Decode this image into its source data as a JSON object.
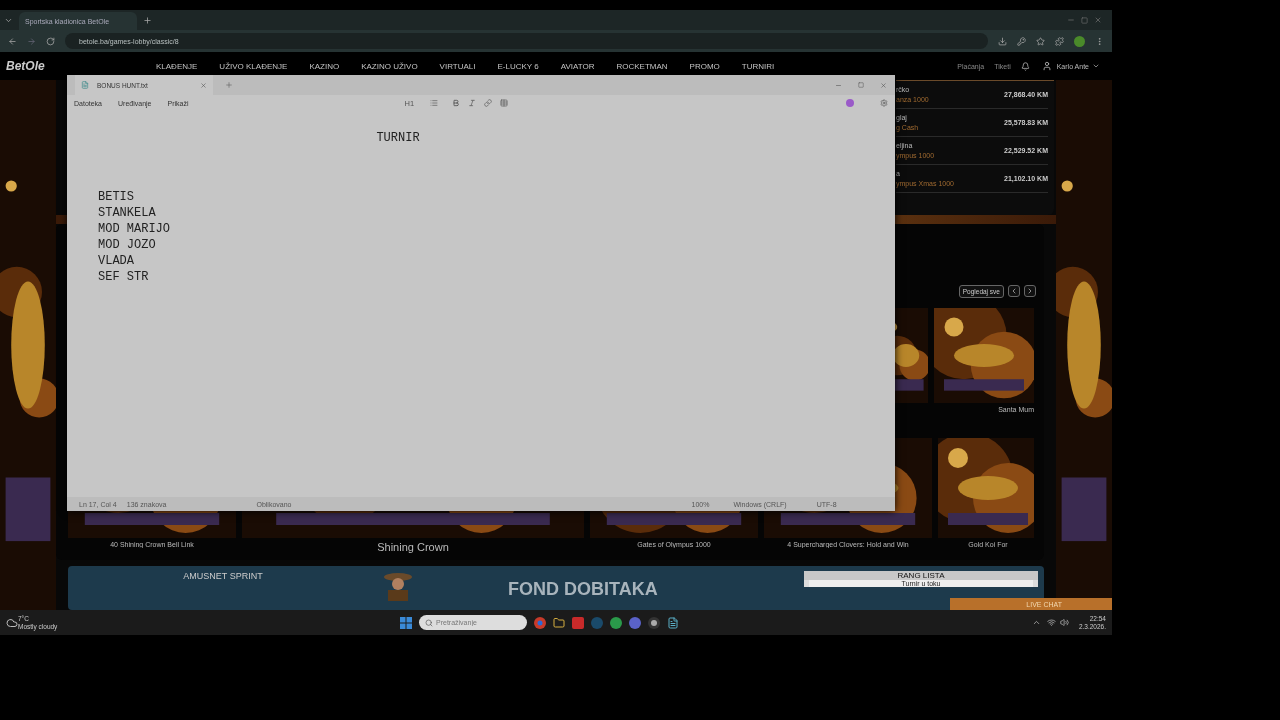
{
  "browser": {
    "tabs": [
      {
        "title": "Sportska kladionica BetOle",
        "selected": true
      }
    ],
    "url": "betole.ba/games-lobby/classic/8"
  },
  "site": {
    "logo": "BetOle",
    "nav": [
      "KLAĐENJE",
      "UŽIVO KLAĐENJE",
      "KAZINO",
      "KAZINO UŽIVO",
      "VIRTUALI",
      "E-LUCKY 6",
      "AVIATOR",
      "ROCKETMAN",
      "PROMO",
      "TURNIRI"
    ],
    "user_links": [
      "Plaćanja",
      "Tiketi"
    ],
    "user_name": "Karlo Ante"
  },
  "leaderboard": [
    {
      "name": "rčko",
      "game": "anza 1000",
      "amount": "27,868.40 KM"
    },
    {
      "name": "glaj",
      "game": "g Cash",
      "amount": "25,578.83 KM"
    },
    {
      "name": "eljina",
      "game": "ympus 1000",
      "amount": "22,529.52 KM"
    },
    {
      "name": "a",
      "game": "ympus Xmas 1000",
      "amount": "21,102.10 KM"
    }
  ],
  "games": {
    "view_all": "Pogledaj sve",
    "top_row": [
      {
        "title": "Santa Mum"
      }
    ],
    "bottom_row": [
      {
        "title": "40 Shining Crown Bell Link",
        "featured": false
      },
      {
        "title": "Shining Crown",
        "featured": true
      },
      {
        "title": "Gates of Olympus 1000",
        "featured": false
      },
      {
        "title": "4 Supercharged Clovers: Hold and Win",
        "featured": false
      },
      {
        "title": "Gold Koi For",
        "featured": false
      }
    ]
  },
  "banner": {
    "title": "AMUSNET SPRINT",
    "headline": "FOND DOBITAKA",
    "ranking_title": "RANG LISTA",
    "ranking_status": "Turnir u toku"
  },
  "live_chat": "LIVE CHAT",
  "notepad": {
    "tab": "BONUS HUNT.txt",
    "menus": [
      "Datoteka",
      "Uređivanje",
      "Prikaži"
    ],
    "heading_style": "H1",
    "heading": "TURNIR",
    "lines": [
      "BETIS",
      "STANKELA",
      "MOD MARIJO",
      "MOD JOZO",
      "VLADA",
      "SEF STR"
    ],
    "status": {
      "position": "Ln 17, Col 4",
      "characters": "136 znakova",
      "format": "Oblikovano",
      "zoom": "100%",
      "line_ending": "Windows (CRLF)",
      "encoding": "UTF-8"
    }
  },
  "taskbar": {
    "temperature": "7°C",
    "weather": "Mostly cloudy",
    "search_placeholder": "Pretraživanje",
    "time": "22:54",
    "date": "2.3.2026."
  }
}
